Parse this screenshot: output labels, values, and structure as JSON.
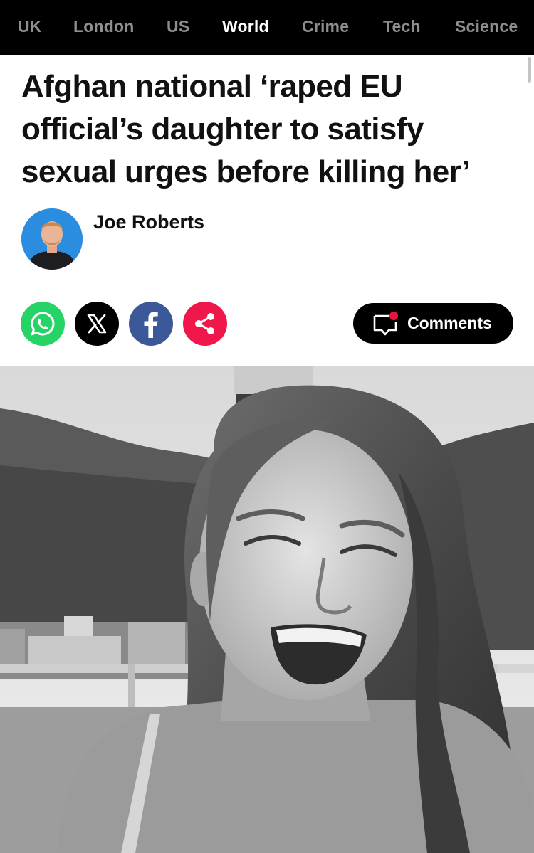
{
  "nav": {
    "items": [
      {
        "label": "UK",
        "active": false
      },
      {
        "label": "London",
        "active": false
      },
      {
        "label": "US",
        "active": false
      },
      {
        "label": "World",
        "active": true
      },
      {
        "label": "Crime",
        "active": false
      },
      {
        "label": "Tech",
        "active": false
      },
      {
        "label": "Science",
        "active": false
      }
    ]
  },
  "article": {
    "headline": "Afghan national ‘raped EU official’s daughter to satisfy sexual urges before killing her’",
    "author": "Joe Roberts"
  },
  "share": {
    "icons": [
      "whatsapp-icon",
      "x-icon",
      "facebook-icon",
      "share-icon"
    ],
    "colors": {
      "whatsapp": "#25d366",
      "x": "#000000",
      "facebook": "#3b5998",
      "share": "#f0184b"
    }
  },
  "comments": {
    "label": "Comments",
    "icon": "comment-bubble-icon",
    "badge_color": "#e8163d"
  },
  "hero_image": {
    "description_icon": "photo-icon",
    "style": "black-and-white"
  }
}
